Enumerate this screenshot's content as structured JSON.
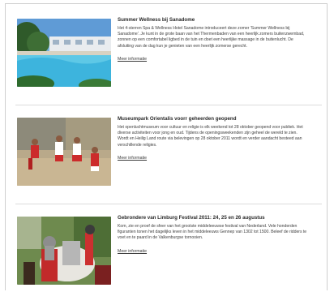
{
  "articles": [
    {
      "title": "Summer Wellness bij Sanadome",
      "description": "Het 4-sterren Spa & Wellness Hotel Sanadome introduceert deze zomer 'Summer Wellness bij Sanadome'. Je kunt in de grote baan van het Thermenbaden van een heerlijk zomers buitenzwembad, zonnen op een comfortabel ligbed in de tuin en doet een heerlijke massage in de buitenlucht. De afsluiting van de dag kun je genieten van een heerlijk zomerse gerecht.",
      "link": "Meer informatie",
      "image": "pool-photo"
    },
    {
      "title": "Museumpark Orientalis voorr geheerden geopend",
      "description": "Het openluchtmuseum voor cultuur en religie is elk weekend tot 28 oktober geopend voor publiek. Het diverse activiteiten voor jong en oud. Tijdens de openingsweekenden zijn geheel de wereld te zien. Wordt en Heilig Land route via belevingen op 28 oktober 2011 wordt en verder aandacht besteed aan verschillende religies.",
      "link": "Meer informatie",
      "image": "dancers-photo"
    },
    {
      "title": "Gebrondere van Limburg Festival 2011: 24, 25 en 26 augustus",
      "description": "Kom, zie en proef de sfeer van het grootste middeleeuwse festival van Nederland. Vele honderden figuranten tonen het dagelijks leven in het middeleeuws Gennep van 1302 tot 1500. Beleef de ridders te voet en te paard in de Valkenburgse tornooien.",
      "link": "Meer informatie",
      "image": "knight-photo"
    }
  ]
}
